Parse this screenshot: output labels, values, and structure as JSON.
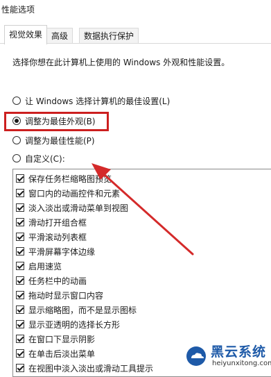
{
  "window": {
    "title": "性能选项"
  },
  "tabs": [
    {
      "label": "视觉效果",
      "active": true
    },
    {
      "label": "高级",
      "active": false
    },
    {
      "label": "数据执行保护",
      "active": false
    }
  ],
  "visual_effects": {
    "description": "选择你想在此计算机上使用的 Windows 外观和性能设置。",
    "options": [
      {
        "label": "让 Windows 选择计算机的最佳设置(L)",
        "checked": false
      },
      {
        "label": "调整为最佳外观(B)",
        "checked": true
      },
      {
        "label": "调整为最佳性能(P)",
        "checked": false
      },
      {
        "label": "自定义(C):",
        "checked": false
      }
    ],
    "effects": [
      {
        "label": "保存任务栏缩略图预览",
        "checked": true
      },
      {
        "label": "窗口内的动画控件和元素",
        "checked": true
      },
      {
        "label": "淡入淡出或滑动菜单到视图",
        "checked": true
      },
      {
        "label": "滑动打开组合框",
        "checked": true
      },
      {
        "label": "平滑滚动列表框",
        "checked": true
      },
      {
        "label": "平滑屏幕字体边缘",
        "checked": true
      },
      {
        "label": "启用速览",
        "checked": true
      },
      {
        "label": "任务栏中的动画",
        "checked": true
      },
      {
        "label": "拖动时显示窗口内容",
        "checked": true
      },
      {
        "label": "显示缩略图，而不是显示图标",
        "checked": true
      },
      {
        "label": "显示亚透明的选择长方形",
        "checked": true
      },
      {
        "label": "在窗口下显示阴影",
        "checked": true
      },
      {
        "label": "在单击后淡出菜单",
        "checked": true
      },
      {
        "label": "在视图中淡入淡出或滑动工具提示",
        "checked": true
      }
    ]
  },
  "annotation": {
    "highlight_color": "#cc1f1f",
    "arrow_color": "#d42a2a"
  },
  "watermark": {
    "title": "黑云系统",
    "url": "heiyunxitong.com",
    "brand_color": "#1e5aa8"
  }
}
